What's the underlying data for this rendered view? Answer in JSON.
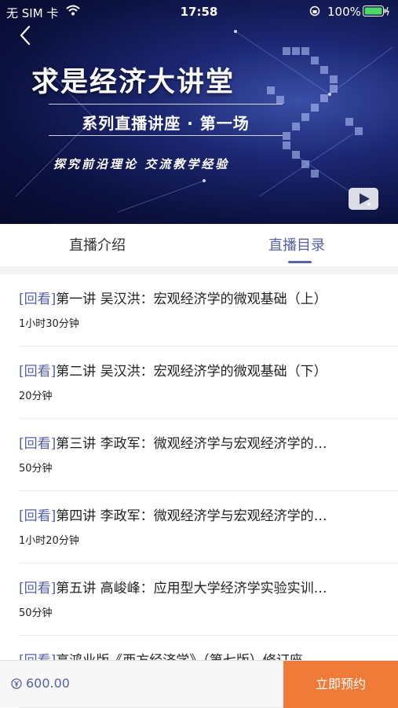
{
  "status_bar": {
    "carrier": "无 SIM 卡",
    "time": "17:58",
    "battery": "100%"
  },
  "banner": {
    "title": "求是经济大讲堂",
    "subtitle": "系列直播讲座 · 第一场",
    "tagline": "探究前沿理论 交流教学经验"
  },
  "tabs": {
    "intro": "直播介绍",
    "catalog": "直播目录",
    "active": "catalog"
  },
  "lectures": [
    {
      "tag": "[回看]",
      "title": "第一讲 吴汉洪：宏观经济学的微观基础（上）",
      "duration": "1小时30分钟"
    },
    {
      "tag": "[回看]",
      "title": "第二讲 吴汉洪：宏观经济学的微观基础（下）",
      "duration": "20分钟"
    },
    {
      "tag": "[回看]",
      "title": "第三讲 李政军：微观经济学与宏观经济学的…",
      "duration": "50分钟"
    },
    {
      "tag": "[回看]",
      "title": "第四讲 李政军：微观经济学与宏观经济学的…",
      "duration": "1小时20分钟"
    },
    {
      "tag": "[回看]",
      "title": "第五讲 高峻峰：应用型大学经济学实验实训…",
      "duration": "50分钟"
    },
    {
      "tag": "[回看]",
      "title": "高鸿业版《西方经济学》（第七版）修订座…",
      "duration": ""
    }
  ],
  "bottom_bar": {
    "price": "600.00",
    "reserve_label": "立即预约"
  },
  "colors": {
    "accent": "#5561a8",
    "button": "#f07a37"
  }
}
